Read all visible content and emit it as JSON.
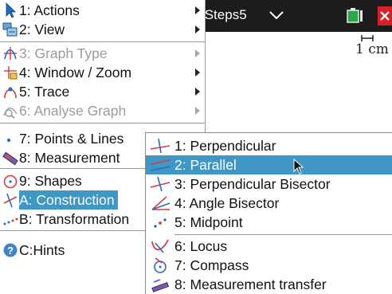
{
  "document": {
    "title": "tSteps5",
    "scale_label": "1 cm"
  },
  "colors": {
    "highlight": "#3f97c6",
    "topbar": "#1c1c1c",
    "close": "#d61f26"
  },
  "main_menu": {
    "items": [
      {
        "label": "1: Actions",
        "icon": "pointer-icon",
        "has_submenu": true,
        "disabled": false
      },
      {
        "label": "2: View",
        "icon": "view-icon",
        "has_submenu": true,
        "disabled": false
      },
      {
        "label": "3: Graph Type",
        "icon": "graph-type-icon",
        "has_submenu": true,
        "disabled": true
      },
      {
        "label": "4: Window / Zoom",
        "icon": "window-zoom-icon",
        "has_submenu": true,
        "disabled": false
      },
      {
        "label": "5: Trace",
        "icon": "trace-icon",
        "has_submenu": true,
        "disabled": false
      },
      {
        "label": "6: Analyse Graph",
        "icon": "analyse-graph-icon",
        "has_submenu": true,
        "disabled": true
      },
      {
        "label": "7: Points & Lines",
        "icon": "points-lines-icon",
        "has_submenu": true,
        "disabled": false
      },
      {
        "label": "8: Measurement",
        "icon": "measurement-icon",
        "has_submenu": true,
        "disabled": false
      },
      {
        "label": "9: Shapes",
        "icon": "shapes-icon",
        "has_submenu": true,
        "disabled": false
      },
      {
        "label": "A: Construction",
        "icon": "construction-icon",
        "has_submenu": true,
        "disabled": false,
        "selected": true
      },
      {
        "label": "B: Transformation",
        "icon": "transformation-icon",
        "has_submenu": true,
        "disabled": false
      },
      {
        "label": "C:Hints",
        "icon": "hints-icon",
        "has_submenu": false,
        "disabled": false
      }
    ]
  },
  "construction_menu": {
    "items": [
      {
        "label": "1: Perpendicular",
        "icon": "perpendicular-icon"
      },
      {
        "label": "2: Parallel",
        "icon": "parallel-icon",
        "selected": true
      },
      {
        "label": "3: Perpendicular Bisector",
        "icon": "perpendicular-bisector-icon"
      },
      {
        "label": "4: Angle Bisector",
        "icon": "angle-bisector-icon"
      },
      {
        "label": "5: Midpoint",
        "icon": "midpoint-icon"
      },
      {
        "label": "6: Locus",
        "icon": "locus-icon"
      },
      {
        "label": "7: Compass",
        "icon": "compass-icon"
      },
      {
        "label": "8: Measurement transfer",
        "icon": "measurement-transfer-icon"
      }
    ]
  }
}
